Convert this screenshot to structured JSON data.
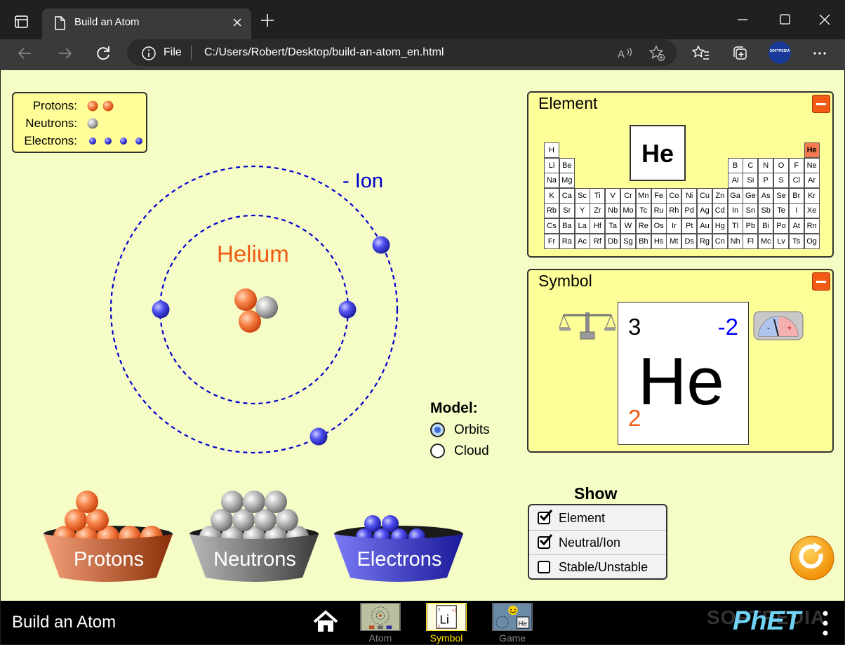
{
  "browser": {
    "tab_title": "Build an Atom",
    "address_scheme_label": "File",
    "url": "C:/Users/Robert/Desktop/build-an-atom_en.html",
    "profile_badge": "SOFTPEDIA"
  },
  "legend": {
    "protons_label": "Protons:",
    "neutrons_label": "Neutrons:",
    "electrons_label": "Electrons:",
    "protons_count": 2,
    "neutrons_count": 1,
    "electrons_count": 4
  },
  "atom": {
    "element_name": "Helium",
    "ion_label": "- Ion",
    "colors": {
      "proton": "#f26b2a",
      "neutron": "#a8a8a8",
      "electron": "#3434e8",
      "orbit": "#0000cc",
      "element_name": "#f05a10"
    }
  },
  "element_panel": {
    "title": "Element",
    "selected_symbol": "He",
    "table": [
      [
        "H",
        "",
        "",
        "",
        "",
        "",
        "",
        "",
        "",
        "",
        "",
        "",
        "",
        "",
        "",
        "",
        "",
        "He"
      ],
      [
        "Li",
        "Be",
        "",
        "",
        "",
        "",
        "",
        "",
        "",
        "",
        "",
        "",
        "B",
        "C",
        "N",
        "O",
        "F",
        "Ne"
      ],
      [
        "Na",
        "Mg",
        "",
        "",
        "",
        "",
        "",
        "",
        "",
        "",
        "",
        "",
        "Al",
        "Si",
        "P",
        "S",
        "Cl",
        "Ar"
      ],
      [
        "K",
        "Ca",
        "Sc",
        "Ti",
        "V",
        "Cr",
        "Mn",
        "Fe",
        "Co",
        "Ni",
        "Cu",
        "Zn",
        "Ga",
        "Ge",
        "As",
        "Se",
        "Br",
        "Kr"
      ],
      [
        "Rb",
        "Sr",
        "Y",
        "Zr",
        "Nb",
        "Mo",
        "Tc",
        "Ru",
        "Rh",
        "Pd",
        "Ag",
        "Cd",
        "In",
        "Sn",
        "Sb",
        "Te",
        "I",
        "Xe"
      ],
      [
        "Cs",
        "Ba",
        "La",
        "Hf",
        "Ta",
        "W",
        "Re",
        "Os",
        "Ir",
        "Pt",
        "Au",
        "Hg",
        "Tl",
        "Pb",
        "Bi",
        "Po",
        "At",
        "Rn"
      ],
      [
        "Fr",
        "Ra",
        "Ac",
        "Rf",
        "Db",
        "Sg",
        "Bh",
        "Hs",
        "Mt",
        "Ds",
        "Rg",
        "Cn",
        "Nh",
        "Fl",
        "Mc",
        "Lv",
        "Ts",
        "Og"
      ]
    ]
  },
  "symbol_panel": {
    "title": "Symbol",
    "mass_number": "3",
    "charge": "-2",
    "symbol": "He",
    "atomic_number": "2",
    "colors": {
      "charge": "#0000ff",
      "atomic_number": "#f05a10"
    }
  },
  "model": {
    "title": "Model:",
    "options": [
      "Orbits",
      "Cloud"
    ],
    "selected": "Orbits"
  },
  "show": {
    "title": "Show",
    "options": [
      {
        "label": "Element",
        "checked": true
      },
      {
        "label": "Neutral/Ion",
        "checked": true
      },
      {
        "label": "Stable/Unstable",
        "checked": false
      }
    ]
  },
  "buckets": {
    "protons": "Protons",
    "neutrons": "Neutrons",
    "electrons": "Electrons"
  },
  "bottom_nav": {
    "app_title": "Build an Atom",
    "screens": [
      "Atom",
      "Symbol",
      "Game"
    ],
    "active_screen": "Symbol",
    "brand": "PhET",
    "watermark": "SOFTPEDIA"
  }
}
